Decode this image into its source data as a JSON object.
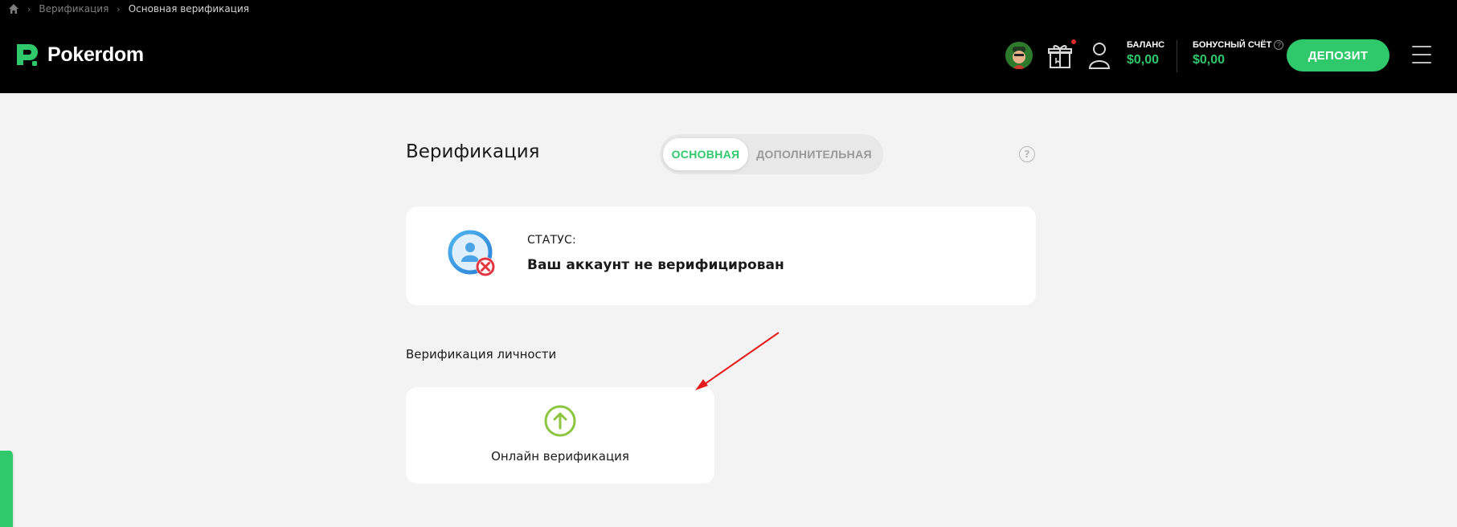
{
  "breadcrumb": {
    "home_icon": "home-icon",
    "items": [
      "Верификация",
      "Основная верификация"
    ]
  },
  "header": {
    "logo_text": "Pokerdom",
    "balance": {
      "label": "БАЛАНС",
      "value": "$0,00"
    },
    "bonus": {
      "label": "БОНУСНЫЙ СЧЁТ",
      "value": "$0,00",
      "help": "?"
    },
    "deposit_label": "ДЕПОЗИТ",
    "colors": {
      "accent": "#2fc86b",
      "background": "#000000",
      "notification": "#e12b2b"
    }
  },
  "main": {
    "title": "Верификация",
    "tabs": [
      {
        "label": "ОСНОВНАЯ",
        "active": true
      },
      {
        "label": "ДОПОЛНИТЕЛЬНАЯ",
        "active": false
      }
    ],
    "help": "?",
    "status": {
      "label": "СТАТУС:",
      "value": "Ваш аккаунт не верифицирован"
    },
    "section_title": "Верификация личности",
    "online_card": {
      "label": "Онлайн верификация",
      "icon": "upload-arrow-icon"
    }
  }
}
